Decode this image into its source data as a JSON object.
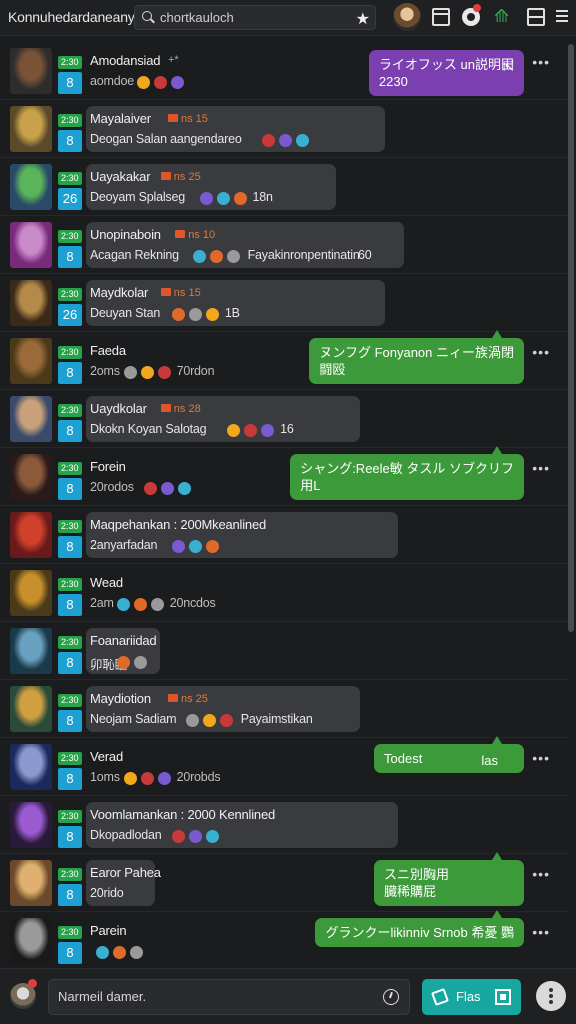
{
  "header": {
    "title": "Konnuhedardaneany",
    "search_value": "chortkauloch",
    "icons": [
      "search-icon",
      "star-icon",
      "calendar-icon",
      "record-icon",
      "tree-icon",
      "layout-icon",
      "menu-icon"
    ]
  },
  "conversations": [
    {
      "name": "Amodansiad",
      "marker": "+*",
      "badge": "2:30",
      "chan": "8",
      "preview": "aomdoe",
      "dim": true,
      "right_bubble": {
        "color": "purple",
        "line1": "ライオフッス un説明田",
        "line2": "2230",
        "icon": "⇱"
      }
    },
    {
      "name": "Mayalaiver",
      "tag": "ns 15",
      "badge": "2:30",
      "chan": "8",
      "preview": "Deogan Salan aangendareo",
      "bubble_w": 385
    },
    {
      "name": "Uayakakar",
      "tag": "ns 25",
      "badge": "2:30",
      "chan": "26",
      "preview": "Deoyam Splalseg",
      "extra": "18n",
      "bubble_w": 336
    },
    {
      "name": "Unopinaboin",
      "tag": "ns 10",
      "badge": "2:30",
      "chan": "8",
      "preview": "Acagan Rekning",
      "extra2": "Fayakinronpentinatin",
      "extra": "60",
      "bubble_w": 404
    },
    {
      "name": "Maydkolar",
      "tag": "ns 15",
      "badge": "2:30",
      "chan": "26",
      "preview": "Deuyan Stan",
      "extra": "1B",
      "bubble_w": 385
    },
    {
      "name": "Faeda",
      "badge": "2:30",
      "chan": "8",
      "preview": "2oms",
      "extra": "70rdon",
      "dim": true,
      "right_bubble": {
        "color": "green",
        "line1": "ヌンフグ Fonyanon ニィー族渦閉",
        "line2": "闘殴"
      }
    },
    {
      "name": "Uaydkolar",
      "tag": "ns 28",
      "badge": "2:30",
      "chan": "8",
      "preview": "Dkokn Koyan Salotag",
      "extra": "16",
      "bubble_w": 360
    },
    {
      "name": "Forein",
      "badge": "2:30",
      "chan": "8",
      "preview": "20rodos",
      "dim": true,
      "right_bubble": {
        "color": "green",
        "line1": "シャング:Reele敏 タスル ソブクリフ",
        "line2": "用L"
      }
    },
    {
      "name": "Maqpehankan : 200Mkeanlined",
      "badge": "2:30",
      "chan": "8",
      "preview": "2anyarfadan",
      "bubble_w": 398
    },
    {
      "name": "Wead",
      "badge": "2:30",
      "chan": "8",
      "preview": "2am",
      "extra": "20ncdos",
      "dim": true
    },
    {
      "name": "Foanariidad",
      "badge": "2:30",
      "chan": "8",
      "preview": "卯恥臨",
      "bubble_w": 160
    },
    {
      "name": "Maydiotion",
      "tag": "ns 25",
      "badge": "2:30",
      "chan": "8",
      "preview": "Neojam Sadiam",
      "extra2": "Payaimstikan",
      "bubble_w": 360
    },
    {
      "name": "Verad",
      "badge": "2:30",
      "chan": "8",
      "preview": "1oms",
      "extra": "20robds",
      "dim": true,
      "right_bubble": {
        "color": "green",
        "line1": "Todest",
        "line2": "",
        "right_text": "las"
      }
    },
    {
      "name": "Voomlamankan : 2000 Kennlined",
      "badge": "2:30",
      "chan": "8",
      "preview": "Dkopadlodan",
      "bubble_w": 398
    },
    {
      "name": "Earor Pahea",
      "badge": "2:30",
      "chan": "8",
      "preview": "20rido",
      "bubble_w": 155,
      "right_bubble": {
        "color": "green",
        "line1": "スニ別胸用",
        "line2": "臓稀購屁"
      }
    },
    {
      "name": "Parein",
      "badge": "2:30",
      "chan": "8",
      "preview": "",
      "right_bubble": {
        "color": "green",
        "line1": "グランクーlikinniv Srnob 希憂 鸚",
        "line2": ""
      }
    }
  ],
  "composer": {
    "placeholder": "Narmeil damer.",
    "send_label": "Flas"
  },
  "colors": {
    "background": "#1b1c1e",
    "accent_teal": "#18a6a0",
    "bubble_green": "#3d9a3a",
    "bubble_purple": "#7b3fb0",
    "badge_green": "#27a14a",
    "badge_blue": "#1da0d2"
  }
}
